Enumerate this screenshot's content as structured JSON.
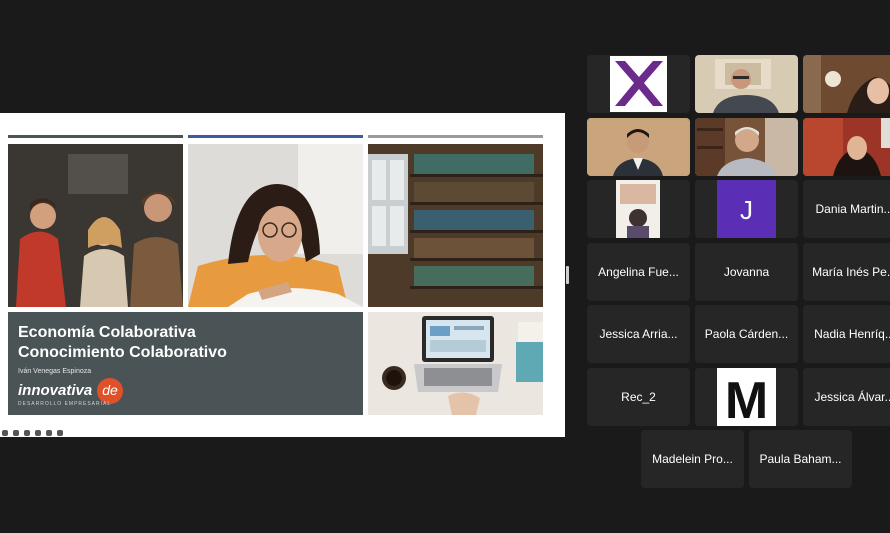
{
  "slide": {
    "title_line1": "Economía Colaborativa",
    "title_line2": "Conocimiento Colaborativo",
    "author": "Iván Venegas Espinoza",
    "logo_word": "innovativa",
    "logo_mark": "de",
    "logo_tagline": "DESARROLLO EMPRESARIAL",
    "photos": [
      "people-talking-photo",
      "student-reading-photo",
      "library-shelves-photo",
      "laptop-desk-photo"
    ]
  },
  "colors": {
    "background": "#1a1a1a",
    "tile": "#262626",
    "active_border": "#4cb248",
    "slide_panel": "#4a5457",
    "logo_accent": "#e0512a",
    "slide_bars": [
      "#4a5457",
      "#3b5ba5",
      "#9a9a9a"
    ],
    "avatar_purple": "#5b2fb5"
  },
  "participants": [
    {
      "name": "",
      "kind": "x-logo-avatar"
    },
    {
      "name": "",
      "kind": "video-man-glasses"
    },
    {
      "name": "",
      "kind": "video-woman"
    },
    {
      "name": "",
      "kind": "video-man-speaking",
      "active": true
    },
    {
      "name": "",
      "kind": "video-man-bookshelf"
    },
    {
      "name": "",
      "kind": "video-woman-red"
    },
    {
      "name": "",
      "kind": "photo-avatar"
    },
    {
      "name": "",
      "kind": "letter-avatar",
      "letter": "J"
    },
    {
      "name": "Dania Martin...",
      "kind": "name"
    },
    {
      "name": "Angelina Fue...",
      "kind": "name"
    },
    {
      "name": "Jovanna",
      "kind": "name"
    },
    {
      "name": "María Inés Pe...",
      "kind": "name"
    },
    {
      "name": "Jessica Arria...",
      "kind": "name"
    },
    {
      "name": "Paola Cárden...",
      "kind": "name"
    },
    {
      "name": "Nadia Henríq...",
      "kind": "name"
    },
    {
      "name": "Rec_2",
      "kind": "name"
    },
    {
      "name": "",
      "kind": "letter-logo-avatar",
      "letter": "M"
    },
    {
      "name": "Jessica Álvar...",
      "kind": "name"
    },
    {
      "name": "Madelein Pro...",
      "kind": "name"
    },
    {
      "name": "Paula Baham...",
      "kind": "name"
    }
  ]
}
